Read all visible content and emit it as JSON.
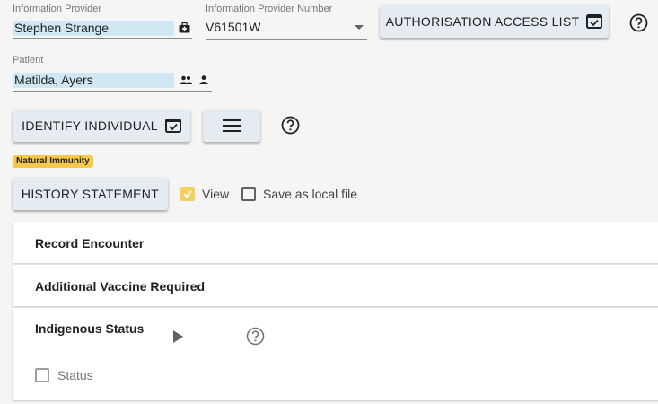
{
  "provider": {
    "label": "Information Provider",
    "value": "Stephen Strange",
    "icon": "medical-bag-icon"
  },
  "provider_number": {
    "label": "Information Provider Number",
    "value": "V61501W",
    "icon": "dropdown-arrow-icon"
  },
  "authorisation_button": {
    "label": "AUTHORISATION ACCESS LIST",
    "icon": "checkbox-window-icon"
  },
  "patient": {
    "label": "Patient",
    "value": "Matilda, Ayers",
    "icons": [
      "people-icon",
      "person-icon"
    ]
  },
  "identify_button": {
    "label": "IDENTIFY INDIVIDUAL",
    "icon": "checkbox-window-icon"
  },
  "menu_button": {
    "icon": "hamburger-menu-icon"
  },
  "badge": {
    "label": "Natural Immunity",
    "color": "#f7c94a"
  },
  "history_button": {
    "label": "HISTORY STATEMENT"
  },
  "view_checkbox": {
    "label": "View",
    "checked": true
  },
  "save_checkbox": {
    "label": "Save as local file",
    "checked": false
  },
  "panels": {
    "record_encounter": {
      "title": "Record Encounter"
    },
    "additional_vaccine": {
      "title": "Additional Vaccine Required"
    },
    "indigenous_status": {
      "title": "Indigenous Status",
      "status_checkbox": {
        "label": "Status",
        "checked": false
      }
    }
  },
  "colors": {
    "background": "#f5f5f5",
    "button": "#e4ecf1",
    "highlight": "#cfe8f3",
    "accent": "#f7c94a"
  }
}
